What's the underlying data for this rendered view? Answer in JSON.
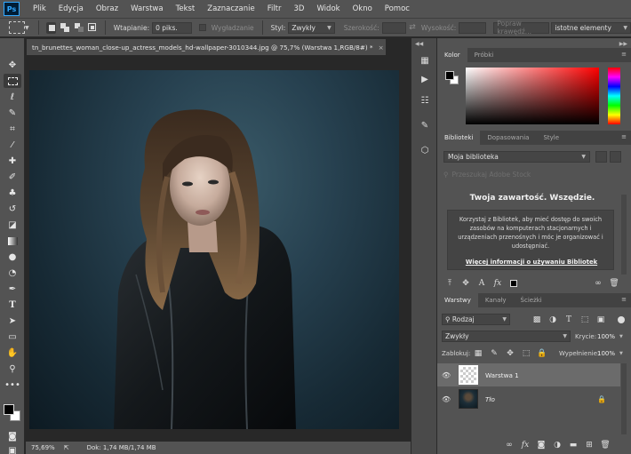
{
  "app": {
    "logo": "Ps"
  },
  "menu": [
    "Plik",
    "Edycja",
    "Obraz",
    "Warstwa",
    "Tekst",
    "Zaznaczanie",
    "Filtr",
    "3D",
    "Widok",
    "Okno",
    "Pomoc"
  ],
  "options": {
    "feather_label": "Wtapianie:",
    "feather_value": "0 piks.",
    "antialias_label": "Wygładzanie",
    "style_label": "Styl:",
    "style_value": "Zwykły",
    "width_label": "Szerokość:",
    "height_label": "Wysokość:",
    "refine_button": "Popraw krawędź...",
    "workspace_value": "istotne elementy"
  },
  "document": {
    "tab_title": "tn_brunettes_woman_close-up_actress_models_hd-wallpaper-3010344.jpg @ 75,7% (Warstwa 1,RGB/8#) *",
    "close_glyph": "×",
    "zoom": "75,69%",
    "doc_size": "Dok: 1,74 MB/1,74 MB"
  },
  "color_panel": {
    "tabs": [
      "Kolor",
      "Próbki"
    ]
  },
  "libraries_panel": {
    "tabs": [
      "Biblioteki",
      "Dopasowania",
      "Style"
    ],
    "library_select": "Moja biblioteka",
    "search_placeholder": "Przeszukaj Adobe Stock",
    "headline": "Twoja zawartość. Wszędzie.",
    "description": "Korzystaj z Bibliotek, aby mieć dostęp do swoich zasobów na komputerach stacjonarnych i urządzeniach przenośnych i móc je organizować i udostępniać.",
    "link": "Więcej informacji o używaniu Bibliotek"
  },
  "layers_panel": {
    "tabs": [
      "Warstwy",
      "Kanały",
      "Ścieżki"
    ],
    "filter_kind": "Rodzaj",
    "blend_mode": "Zwykły",
    "opacity_label": "Krycie:",
    "opacity_value": "100%",
    "lock_label": "Zablokuj:",
    "fill_label": "Wypełnienie:",
    "fill_value": "100%",
    "layers": [
      {
        "name": "Warstwa 1",
        "selected": true
      },
      {
        "name": "Tło",
        "selected": false
      }
    ]
  },
  "colors": {
    "accent": "#31a8ff",
    "panel": "#535353",
    "canvas": "#282828"
  }
}
